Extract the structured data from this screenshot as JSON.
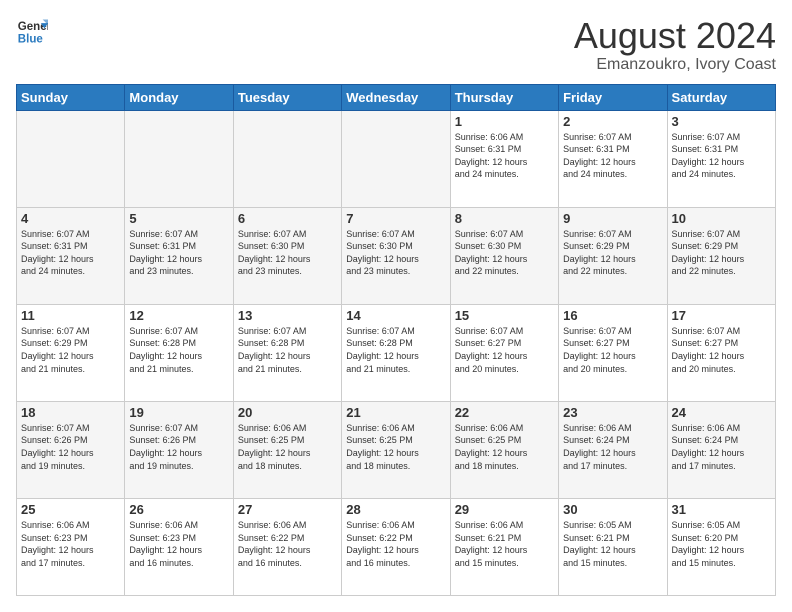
{
  "logo": {
    "line1": "General",
    "line2": "Blue"
  },
  "title": "August 2024",
  "subtitle": "Emanzoukro, Ivory Coast",
  "days_of_week": [
    "Sunday",
    "Monday",
    "Tuesday",
    "Wednesday",
    "Thursday",
    "Friday",
    "Saturday"
  ],
  "weeks": [
    [
      {
        "day": "",
        "info": ""
      },
      {
        "day": "",
        "info": ""
      },
      {
        "day": "",
        "info": ""
      },
      {
        "day": "",
        "info": ""
      },
      {
        "day": "1",
        "info": "Sunrise: 6:06 AM\nSunset: 6:31 PM\nDaylight: 12 hours\nand 24 minutes."
      },
      {
        "day": "2",
        "info": "Sunrise: 6:07 AM\nSunset: 6:31 PM\nDaylight: 12 hours\nand 24 minutes."
      },
      {
        "day": "3",
        "info": "Sunrise: 6:07 AM\nSunset: 6:31 PM\nDaylight: 12 hours\nand 24 minutes."
      }
    ],
    [
      {
        "day": "4",
        "info": "Sunrise: 6:07 AM\nSunset: 6:31 PM\nDaylight: 12 hours\nand 24 minutes."
      },
      {
        "day": "5",
        "info": "Sunrise: 6:07 AM\nSunset: 6:31 PM\nDaylight: 12 hours\nand 23 minutes."
      },
      {
        "day": "6",
        "info": "Sunrise: 6:07 AM\nSunset: 6:30 PM\nDaylight: 12 hours\nand 23 minutes."
      },
      {
        "day": "7",
        "info": "Sunrise: 6:07 AM\nSunset: 6:30 PM\nDaylight: 12 hours\nand 23 minutes."
      },
      {
        "day": "8",
        "info": "Sunrise: 6:07 AM\nSunset: 6:30 PM\nDaylight: 12 hours\nand 22 minutes."
      },
      {
        "day": "9",
        "info": "Sunrise: 6:07 AM\nSunset: 6:29 PM\nDaylight: 12 hours\nand 22 minutes."
      },
      {
        "day": "10",
        "info": "Sunrise: 6:07 AM\nSunset: 6:29 PM\nDaylight: 12 hours\nand 22 minutes."
      }
    ],
    [
      {
        "day": "11",
        "info": "Sunrise: 6:07 AM\nSunset: 6:29 PM\nDaylight: 12 hours\nand 21 minutes."
      },
      {
        "day": "12",
        "info": "Sunrise: 6:07 AM\nSunset: 6:28 PM\nDaylight: 12 hours\nand 21 minutes."
      },
      {
        "day": "13",
        "info": "Sunrise: 6:07 AM\nSunset: 6:28 PM\nDaylight: 12 hours\nand 21 minutes."
      },
      {
        "day": "14",
        "info": "Sunrise: 6:07 AM\nSunset: 6:28 PM\nDaylight: 12 hours\nand 21 minutes."
      },
      {
        "day": "15",
        "info": "Sunrise: 6:07 AM\nSunset: 6:27 PM\nDaylight: 12 hours\nand 20 minutes."
      },
      {
        "day": "16",
        "info": "Sunrise: 6:07 AM\nSunset: 6:27 PM\nDaylight: 12 hours\nand 20 minutes."
      },
      {
        "day": "17",
        "info": "Sunrise: 6:07 AM\nSunset: 6:27 PM\nDaylight: 12 hours\nand 20 minutes."
      }
    ],
    [
      {
        "day": "18",
        "info": "Sunrise: 6:07 AM\nSunset: 6:26 PM\nDaylight: 12 hours\nand 19 minutes."
      },
      {
        "day": "19",
        "info": "Sunrise: 6:07 AM\nSunset: 6:26 PM\nDaylight: 12 hours\nand 19 minutes."
      },
      {
        "day": "20",
        "info": "Sunrise: 6:06 AM\nSunset: 6:25 PM\nDaylight: 12 hours\nand 18 minutes."
      },
      {
        "day": "21",
        "info": "Sunrise: 6:06 AM\nSunset: 6:25 PM\nDaylight: 12 hours\nand 18 minutes."
      },
      {
        "day": "22",
        "info": "Sunrise: 6:06 AM\nSunset: 6:25 PM\nDaylight: 12 hours\nand 18 minutes."
      },
      {
        "day": "23",
        "info": "Sunrise: 6:06 AM\nSunset: 6:24 PM\nDaylight: 12 hours\nand 17 minutes."
      },
      {
        "day": "24",
        "info": "Sunrise: 6:06 AM\nSunset: 6:24 PM\nDaylight: 12 hours\nand 17 minutes."
      }
    ],
    [
      {
        "day": "25",
        "info": "Sunrise: 6:06 AM\nSunset: 6:23 PM\nDaylight: 12 hours\nand 17 minutes."
      },
      {
        "day": "26",
        "info": "Sunrise: 6:06 AM\nSunset: 6:23 PM\nDaylight: 12 hours\nand 16 minutes."
      },
      {
        "day": "27",
        "info": "Sunrise: 6:06 AM\nSunset: 6:22 PM\nDaylight: 12 hours\nand 16 minutes."
      },
      {
        "day": "28",
        "info": "Sunrise: 6:06 AM\nSunset: 6:22 PM\nDaylight: 12 hours\nand 16 minutes."
      },
      {
        "day": "29",
        "info": "Sunrise: 6:06 AM\nSunset: 6:21 PM\nDaylight: 12 hours\nand 15 minutes."
      },
      {
        "day": "30",
        "info": "Sunrise: 6:05 AM\nSunset: 6:21 PM\nDaylight: 12 hours\nand 15 minutes."
      },
      {
        "day": "31",
        "info": "Sunrise: 6:05 AM\nSunset: 6:20 PM\nDaylight: 12 hours\nand 15 minutes."
      }
    ]
  ],
  "colors": {
    "header_bg": "#2a7abf",
    "header_text": "#ffffff",
    "border": "#cccccc",
    "empty_bg": "#f5f5f5",
    "alt_row_bg": "#f9f9f9"
  }
}
